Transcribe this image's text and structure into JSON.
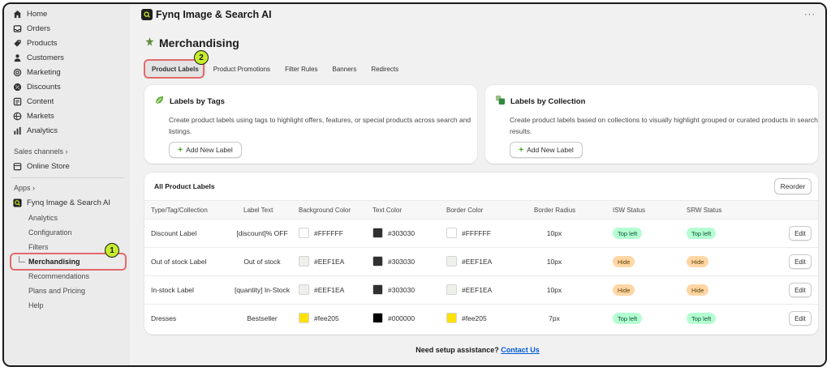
{
  "sidebar": {
    "nav": [
      {
        "label": "Home",
        "icon": "home-icon"
      },
      {
        "label": "Orders",
        "icon": "inbox-icon"
      },
      {
        "label": "Products",
        "icon": "tag-icon"
      },
      {
        "label": "Customers",
        "icon": "person-icon"
      },
      {
        "label": "Marketing",
        "icon": "target-icon"
      },
      {
        "label": "Discounts",
        "icon": "discount-icon"
      },
      {
        "label": "Content",
        "icon": "content-icon"
      },
      {
        "label": "Markets",
        "icon": "globe-icon"
      },
      {
        "label": "Analytics",
        "icon": "bar-chart-icon"
      }
    ],
    "sales_channels_label": "Sales channels",
    "online_store_label": "Online Store",
    "apps_label": "Apps",
    "app_name": "Fynq Image & Search AI",
    "app_subitems": [
      "Analytics",
      "Configuration",
      "Filters",
      "Merchandising",
      "Recommendations",
      "Plans and Pricing",
      "Help"
    ]
  },
  "annotations": {
    "step1": "1",
    "step2": "2"
  },
  "header": {
    "app_title": "Fynq Image & Search AI",
    "more": "···"
  },
  "page": {
    "title": "Merchandising",
    "tabs": [
      "Product Labels",
      "Product Promotions",
      "Filter Rules",
      "Banners",
      "Redirects"
    ]
  },
  "cards": {
    "tags": {
      "title": "Labels by Tags",
      "desc": "Create product labels using tags to highlight offers, features, or special products across search and listings.",
      "button": "Add New Label"
    },
    "collection": {
      "title": "Labels by Collection",
      "desc": "Create product labels based on collections to visually highlight grouped or curated products in search results.",
      "button": "Add New Label"
    }
  },
  "table": {
    "title": "All Product Labels",
    "reorder": "Reorder",
    "headers": [
      "Type/Tag/Collection",
      "Label Text",
      "Background Color",
      "Text Color",
      "Border Color",
      "Border Radius",
      "ISW Status",
      "SRW Status"
    ],
    "edit_label": "Edit",
    "rows": [
      {
        "type": "Discount Label",
        "text": "[discount]% OFF",
        "bg": "#FFFFFF",
        "tc": "#303030",
        "bc": "#FFFFFF",
        "radius": "10px",
        "isw": "Top left",
        "srw": "Top left",
        "isw_kind": "green",
        "srw_kind": "green"
      },
      {
        "type": "Out of stock Label",
        "text": "Out of stock",
        "bg": "#EEF1EA",
        "tc": "#303030",
        "bc": "#EEF1EA",
        "radius": "10px",
        "isw": "Hide",
        "srw": "Hide",
        "isw_kind": "orange",
        "srw_kind": "orange"
      },
      {
        "type": "In-stock Label",
        "text": "[quantity] In-Stock",
        "bg": "#EEF1EA",
        "tc": "#303030",
        "bc": "#EEF1EA",
        "radius": "10px",
        "isw": "Hide",
        "srw": "Hide",
        "isw_kind": "orange",
        "srw_kind": "orange"
      },
      {
        "type": "Dresses",
        "text": "Bestseller",
        "bg": "#fee205",
        "tc": "#000000",
        "bc": "#fee205",
        "radius": "7px",
        "isw": "Top left",
        "srw": "Top left",
        "isw_kind": "green",
        "srw_kind": "green"
      }
    ]
  },
  "footer": {
    "text": "Need setup assistance?",
    "link": "Contact Us"
  }
}
